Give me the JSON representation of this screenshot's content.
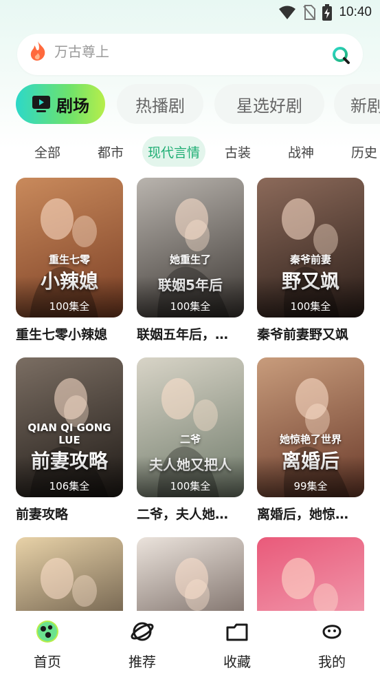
{
  "status_bar": {
    "time": "10:40"
  },
  "search": {
    "placeholder": "万古尊上"
  },
  "main_tabs": [
    {
      "label": "剧场",
      "active": true
    },
    {
      "label": "热播剧"
    },
    {
      "label": "星选好剧"
    },
    {
      "label": "新剧"
    }
  ],
  "sub_tabs": [
    {
      "label": "全部"
    },
    {
      "label": "都市"
    },
    {
      "label": "现代言情",
      "active": true
    },
    {
      "label": "古装"
    },
    {
      "label": "战神"
    },
    {
      "label": "历史"
    }
  ],
  "dramas": [
    {
      "title": "重生七零小辣媳",
      "episodes": "100集全",
      "poster_text": "小辣媳",
      "poster_sub": "重生七零",
      "colors": [
        "#c98a5c",
        "#7a3e24"
      ]
    },
    {
      "title": "联姻五年后，…",
      "episodes": "100集全",
      "poster_text": "联姻5年后",
      "poster_sub": "她重生了",
      "colors": [
        "#b9b4ae",
        "#3b3632"
      ]
    },
    {
      "title": "秦爷前妻野又飒",
      "episodes": "100集全",
      "poster_text": "野又飒",
      "poster_sub": "秦爷前妻",
      "colors": [
        "#8c6a5a",
        "#2a1d18"
      ]
    },
    {
      "title": "前妻攻略",
      "episodes": "106集全",
      "poster_text": "前妻攻略",
      "poster_sub": "QIAN QI GONG LUE",
      "colors": [
        "#7b6e63",
        "#1f1a16"
      ]
    },
    {
      "title": "二爷，夫人她…",
      "episodes": "100集全",
      "poster_text": "夫人她又把人",
      "poster_sub": "二爷",
      "colors": [
        "#d8d4c7",
        "#6f7a6a"
      ]
    },
    {
      "title": "离婚后，她惊…",
      "episodes": "99集全",
      "poster_text": "离婚后",
      "poster_sub": "她惊艳了世界",
      "colors": [
        "#c89c7c",
        "#6a3a2a"
      ]
    },
    {
      "title": "",
      "episodes": "",
      "poster_text": "",
      "poster_sub": "",
      "colors": [
        "#e8d2a8",
        "#3a2e24"
      ]
    },
    {
      "title": "",
      "episodes": "",
      "poster_text": "",
      "poster_sub": "",
      "colors": [
        "#ebe3dc",
        "#4a3a34"
      ]
    },
    {
      "title": "",
      "episodes": "",
      "poster_text": "",
      "poster_sub": "",
      "colors": [
        "#e95a7a",
        "#f4b6c4"
      ]
    }
  ],
  "bottom_nav": [
    {
      "label": "首页",
      "icon": "home-icon",
      "active": true
    },
    {
      "label": "推荐",
      "icon": "planet-icon"
    },
    {
      "label": "收藏",
      "icon": "folder-icon"
    },
    {
      "label": "我的",
      "icon": "profile-icon"
    }
  ],
  "colors": {
    "accent": "#1fae74",
    "tab_gradient_start": "#2dd8c8",
    "tab_gradient_end": "#b7ee4a",
    "fire": "#ff6a3d"
  }
}
